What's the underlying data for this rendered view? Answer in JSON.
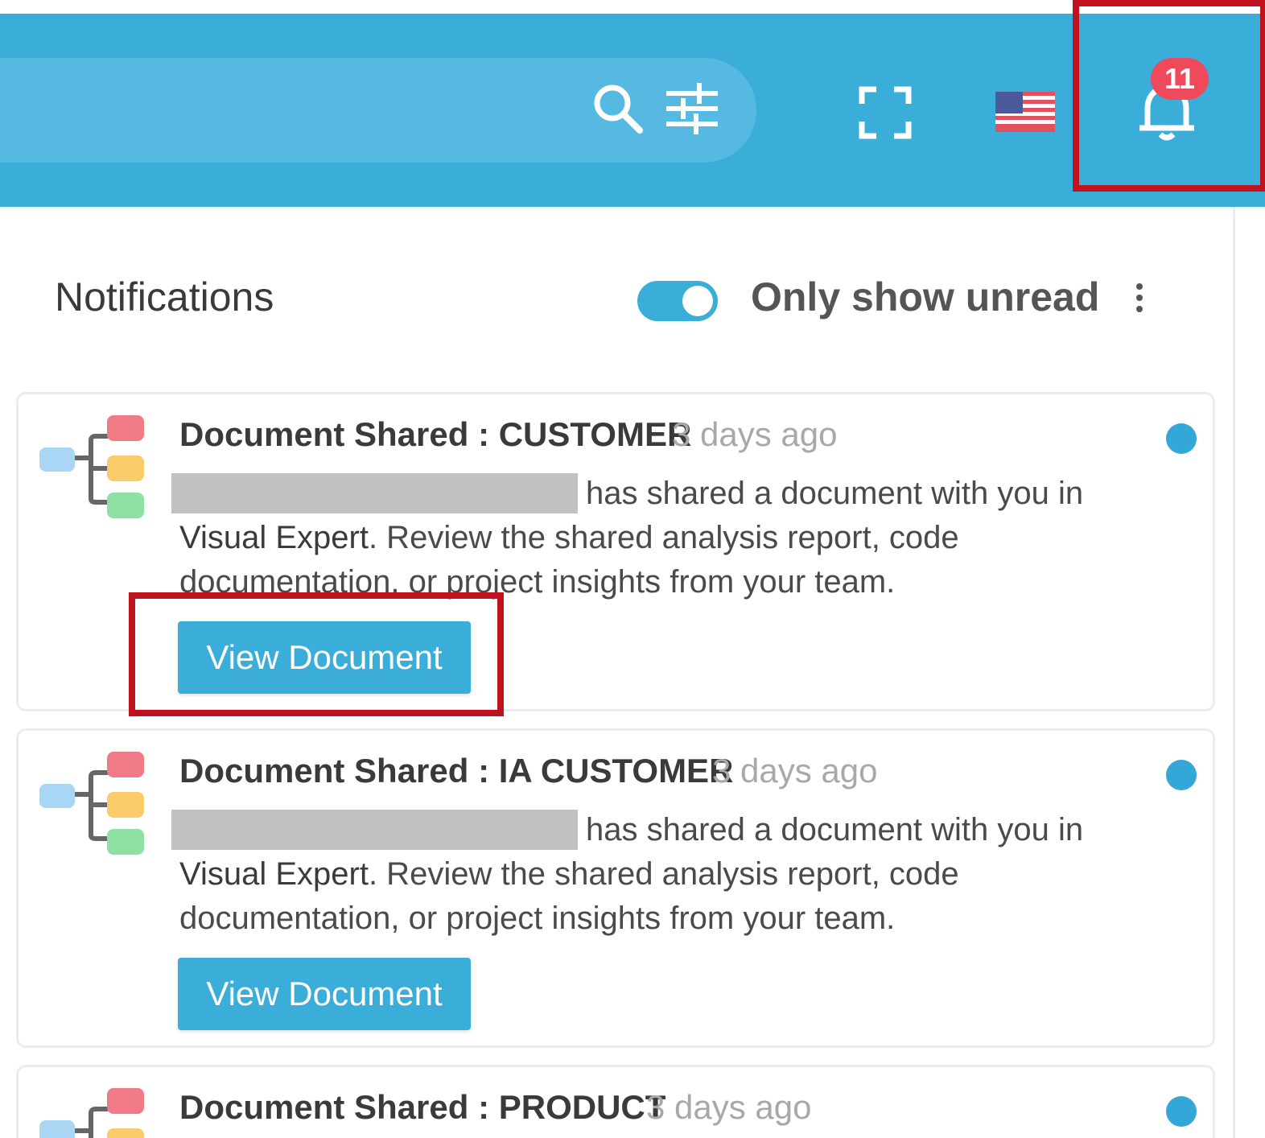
{
  "topbar": {
    "background": "#3aaed9",
    "icons": {
      "search": "search-icon",
      "filter": "filter-sliders-icon",
      "fullscreen": "fullscreen-icon",
      "language": "us-flag-icon",
      "notifications": "bell-icon"
    },
    "notification_count": "11"
  },
  "panel": {
    "title": "Notifications",
    "toggle_label": "Only show unread",
    "toggle_on": true,
    "more_icon": "more-vertical-icon"
  },
  "notifications": [
    {
      "title": "Document Shared : CUSTOMER",
      "time": "3 days ago",
      "body_1": "has shared a document with you in ",
      "brand": "Visual Expert",
      "body_2": ". Review the shared analysis report, code documentation, or project insights from your team.",
      "button": "View Document",
      "unread": true,
      "icon": "mind-map-icon"
    },
    {
      "title": "Document Shared : IA CUSTOMER",
      "time": "3 days ago",
      "body_1": "has shared a document with you in ",
      "brand": "Visual Expert",
      "body_2": ". Review the shared analysis report, code documentation, or project insights from your team.",
      "button": "View Document",
      "unread": true,
      "icon": "mind-map-icon"
    },
    {
      "title": "Document Shared : PRODUCT",
      "time": "3 days ago",
      "unread": true,
      "icon": "mind-map-icon"
    }
  ],
  "colors": {
    "accent": "#3aaed9",
    "badge": "#ee4a5b",
    "highlight": "#c0111f",
    "unread_dot": "#32a7d8"
  }
}
